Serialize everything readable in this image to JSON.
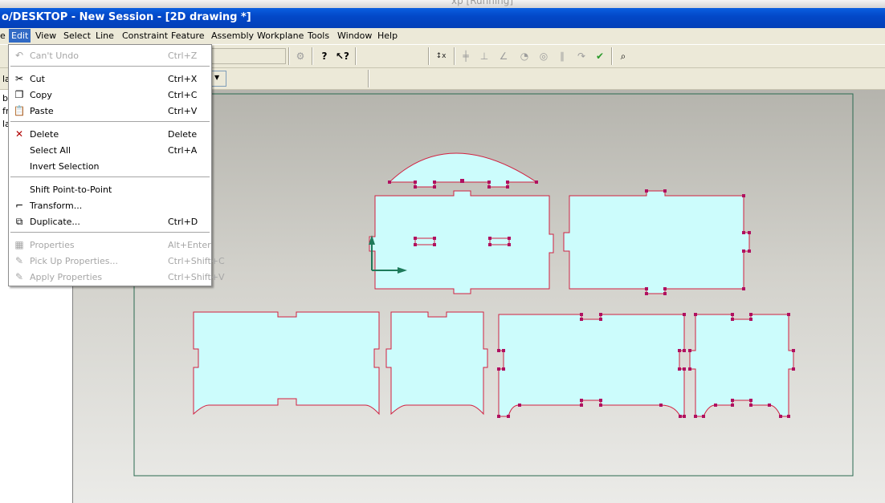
{
  "host_title": "xp [Running]",
  "window_title": "o/DESKTOP - New Session - [2D drawing *]",
  "menubar": {
    "items": [
      "e",
      "Edit",
      "View",
      "Select",
      "Line",
      "Constraint",
      "Feature",
      "Assembly",
      "Workplane",
      "Tools",
      "Window",
      "Help"
    ],
    "active": "Edit"
  },
  "tree": {
    "items": [
      "la",
      "b",
      "fr",
      "la"
    ]
  },
  "toolbar": {
    "icons": [
      "gear-icon",
      "help-icon",
      "whats-this-icon",
      "axis-icon",
      "horizontal-constraint-icon",
      "perpendicular-icon",
      "angle-icon",
      "tangent-icon",
      "concentric-icon",
      "parallel-icon",
      "sketch-icon",
      "dimension-icon",
      "zoom-icon"
    ]
  },
  "edit_menu": {
    "items": [
      {
        "label": "Can't Undo",
        "shortcut": "Ctrl+Z",
        "disabled": true,
        "icon": "undo-icon"
      },
      {
        "label": "Cut",
        "shortcut": "Ctrl+X",
        "disabled": false,
        "icon": "scissors-icon"
      },
      {
        "label": "Copy",
        "shortcut": "Ctrl+C",
        "disabled": false,
        "icon": "copy-icon"
      },
      {
        "label": "Paste",
        "shortcut": "Ctrl+V",
        "disabled": false,
        "icon": "paste-icon"
      },
      {
        "label": "Delete",
        "shortcut": "Delete",
        "disabled": false,
        "icon": "delete-icon"
      },
      {
        "label": "Select All",
        "shortcut": "Ctrl+A",
        "disabled": false,
        "icon": ""
      },
      {
        "label": "Invert Selection",
        "shortcut": "",
        "disabled": false,
        "icon": ""
      },
      {
        "label": "Shift Point-to-Point",
        "shortcut": "",
        "disabled": false,
        "icon": ""
      },
      {
        "label": "Transform...",
        "shortcut": "",
        "disabled": false,
        "icon": "transform-icon"
      },
      {
        "label": "Duplicate...",
        "shortcut": "Ctrl+D",
        "disabled": false,
        "icon": "duplicate-icon"
      },
      {
        "label": "Properties",
        "shortcut": "Alt+Enter",
        "disabled": true,
        "icon": "properties-icon"
      },
      {
        "label": "Pick Up Properties...",
        "shortcut": "Ctrl+Shift+C",
        "disabled": true,
        "icon": "pickup-icon"
      },
      {
        "label": "Apply Properties",
        "shortcut": "Ctrl+Shift+V",
        "disabled": true,
        "icon": "apply-icon"
      }
    ]
  },
  "colors": {
    "shape_fill": "#ccfcfc",
    "shape_stroke": "#d22040",
    "vertex": "#b01060",
    "axis": "#1e7a5a",
    "border": "#2a6a50",
    "menu_highlight": "#316ac5",
    "titlebar": "#0348c8"
  }
}
